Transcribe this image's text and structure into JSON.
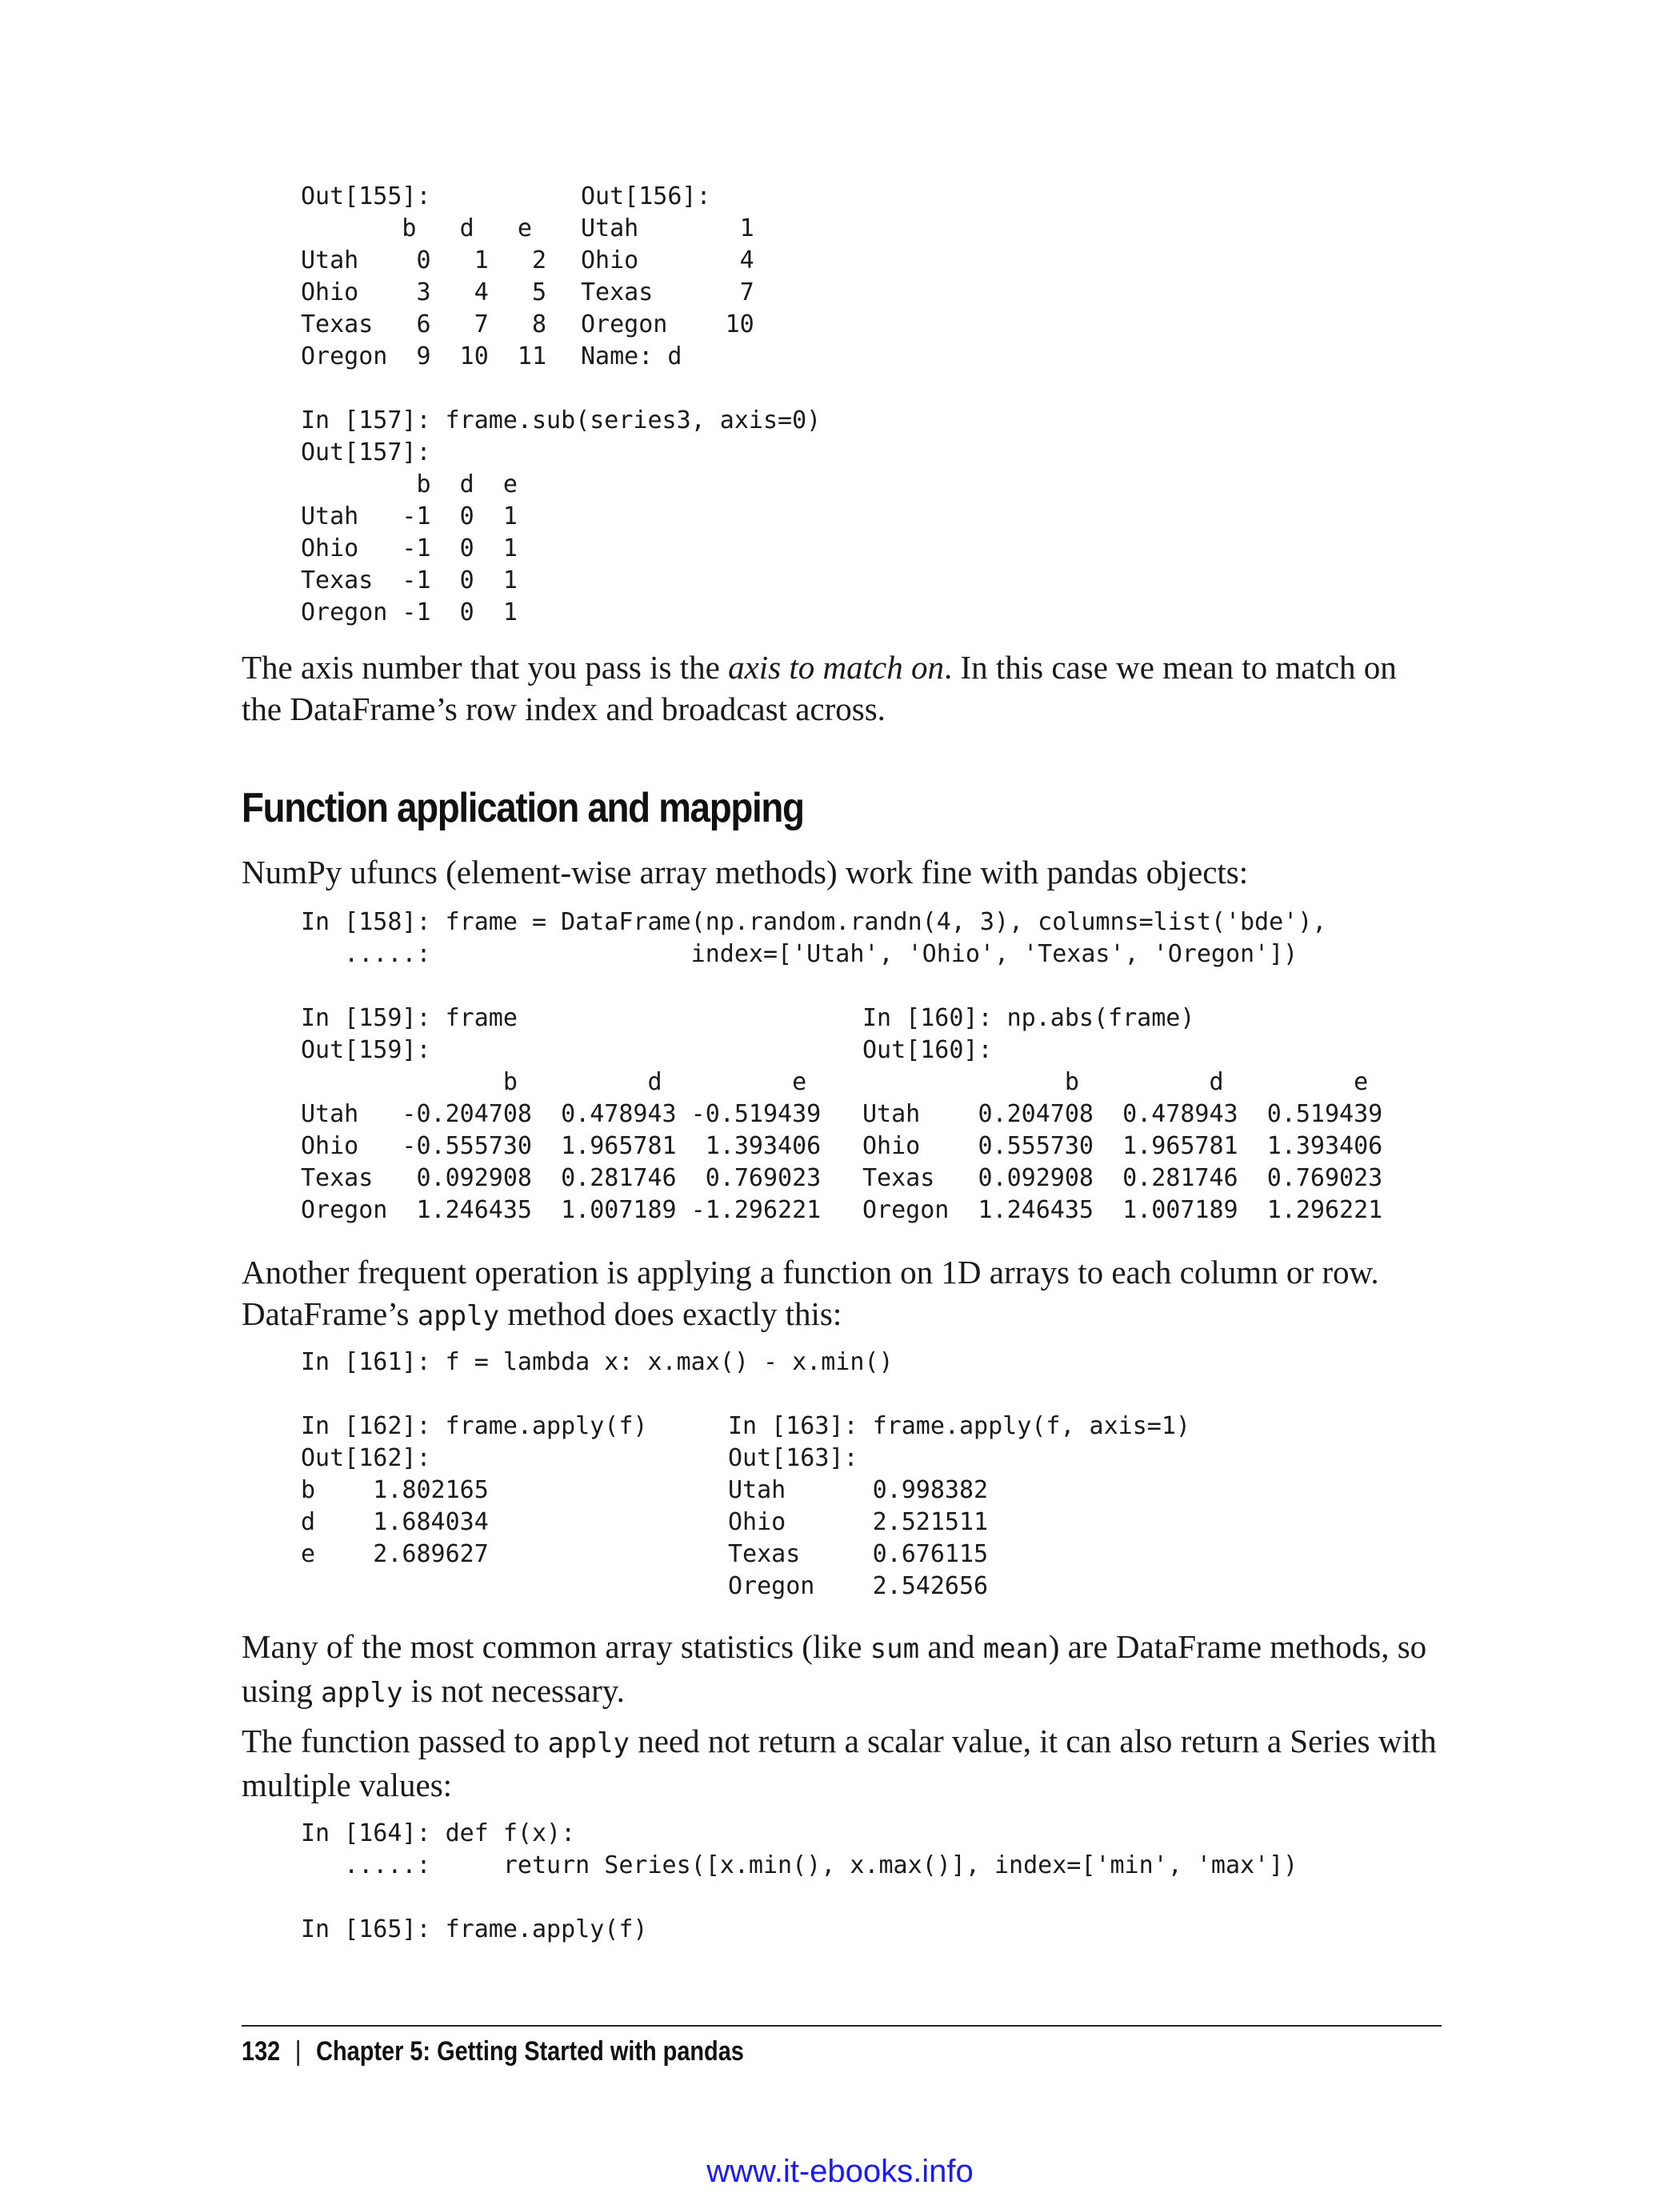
{
  "code_blocks": {
    "out155": "Out[155]:\n       b   d   e\nUtah    0   1   2\nOhio    3   4   5\nTexas   6   7   8\nOregon  9  10  11",
    "out156": "Out[156]:\nUtah       1\nOhio       4\nTexas      7\nOregon    10\nName: d",
    "in157": "In [157]: frame.sub(series3, axis=0)\nOut[157]:\n        b  d  e\nUtah   -1  0  1\nOhio   -1  0  1\nTexas  -1  0  1\nOregon -1  0  1",
    "in158": "In [158]: frame = DataFrame(np.random.randn(4, 3), columns=list('bde'),\n   .....:                  index=['Utah', 'Ohio', 'Texas', 'Oregon'])",
    "in159": "In [159]: frame\nOut[159]:\n              b         d         e\nUtah   -0.204708  0.478943 -0.519439\nOhio   -0.555730  1.965781  1.393406\nTexas   0.092908  0.281746  0.769023\nOregon  1.246435  1.007189 -1.296221",
    "in160": "In [160]: np.abs(frame)\nOut[160]:\n              b         d         e\nUtah    0.204708  0.478943  0.519439\nOhio    0.555730  1.965781  1.393406\nTexas   0.092908  0.281746  0.769023\nOregon  1.246435  1.007189  1.296221",
    "in161": "In [161]: f = lambda x: x.max() - x.min()",
    "in162": "In [162]: frame.apply(f)\nOut[162]:\nb    1.802165\nd    1.684034\ne    2.689627",
    "in163": "In [163]: frame.apply(f, axis=1)\nOut[163]:\nUtah      0.998382\nOhio      2.521511\nTexas     0.676115\nOregon    2.542656",
    "in164": "In [164]: def f(x):\n   .....:     return Series([x.min(), x.max()], index=['min', 'max'])",
    "in165": "In [165]: frame.apply(f)"
  },
  "paragraphs": {
    "p1_a": "The axis number that you pass is the ",
    "p1_em": "axis to match on",
    "p1_b": ". In this case we mean to match on the DataFrame’s row index and broadcast across.",
    "p2": "NumPy ufuncs (element-wise array methods) work fine with pandas objects:",
    "p3_a": "Another frequent operation is applying a function on 1D arrays to each column or row. DataFrame’s ",
    "p3_code": "apply",
    "p3_b": " method does exactly this:",
    "p4_a": "Many of the most common array statistics (like ",
    "p4_code1": "sum",
    "p4_mid": " and ",
    "p4_code2": "mean",
    "p4_b": ") are DataFrame methods, so using ",
    "p4_code3": "apply",
    "p4_c": " is not necessary.",
    "p5_a": "The function passed to ",
    "p5_code": "apply",
    "p5_b": " need not return a scalar value, it can also return a Series with multiple values:"
  },
  "section_heading": "Function application and mapping",
  "footer": {
    "page_number": "132",
    "separator": "|",
    "chapter": "Chapter 5: Getting Started with pandas"
  },
  "watermark": "www.it-ebooks.info"
}
